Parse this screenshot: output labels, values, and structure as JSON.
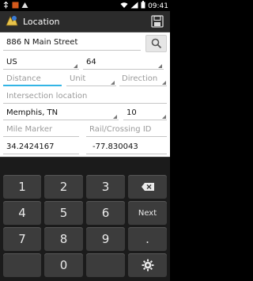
{
  "status_bar": {
    "time": "09:41"
  },
  "action_bar": {
    "title": "Location"
  },
  "form": {
    "address": "886 N Main Street",
    "country": "US",
    "state_code": "64",
    "distance_placeholder": "Distance",
    "unit_placeholder": "Unit",
    "direction_placeholder": "Direction",
    "intersection_placeholder": "Intersection location",
    "city": "Memphis, TN",
    "city_code": "10",
    "mile_marker_placeholder": "Mile Marker",
    "rail_crossing_placeholder": "Rail/Crossing ID",
    "latitude": "34.2424167",
    "longitude": "-77.830043"
  },
  "keyboard": {
    "keys": [
      "1",
      "2",
      "3",
      "4",
      "5",
      "6",
      "7",
      "8",
      "9",
      "0",
      "."
    ],
    "next_label": "Next"
  }
}
